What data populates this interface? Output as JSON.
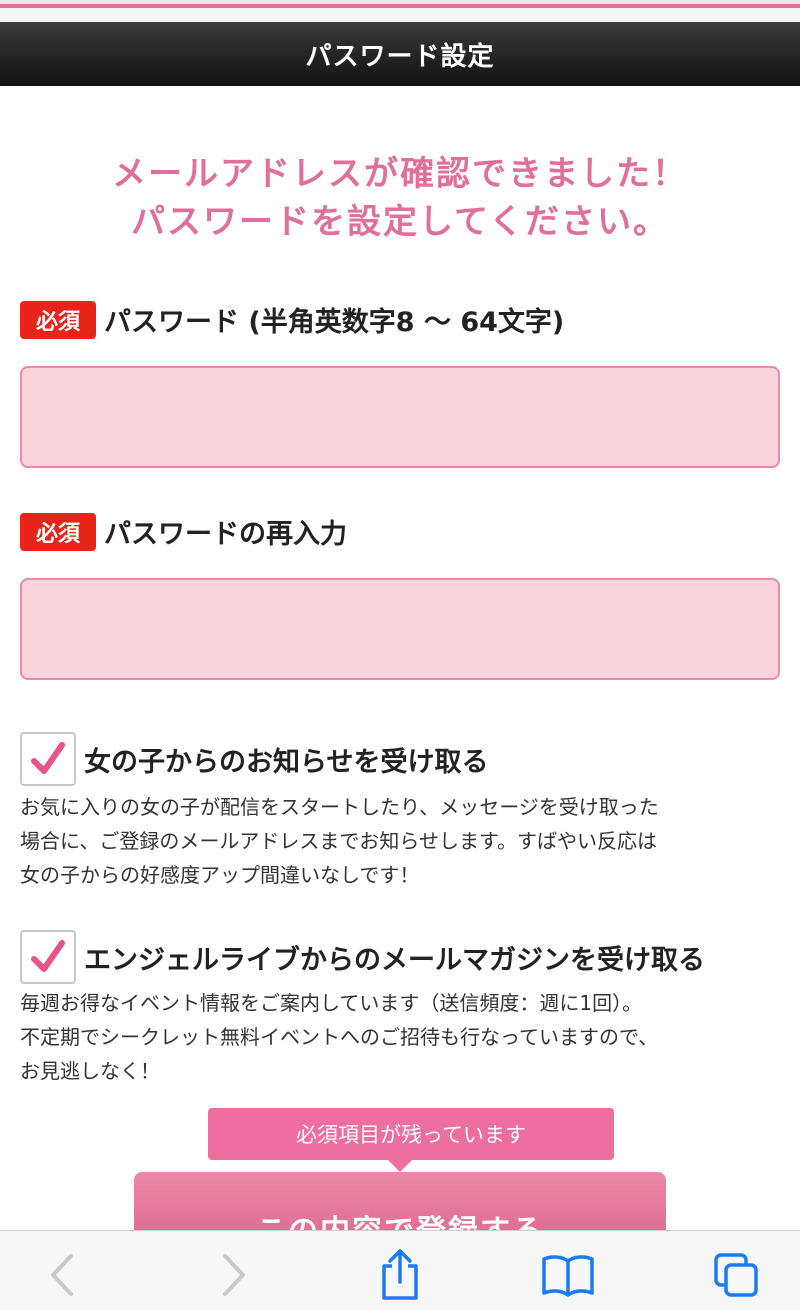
{
  "header": {
    "title": "パスワード設定"
  },
  "headline": {
    "line1": "メールアドレスが確認できました！",
    "line2": "パスワードを設定してください。"
  },
  "form": {
    "password": {
      "required_badge": "必須",
      "label": "パスワード (半角英数字8 〜 64文字)",
      "value": ""
    },
    "password_confirm": {
      "required_badge": "必須",
      "label": "パスワードの再入力",
      "value": ""
    }
  },
  "notifications": {
    "girl_news": {
      "checked": true,
      "title": "女の子からのお知らせを受け取る",
      "lines": [
        "お気に入りの女の子が配信をスタートしたり、メッセージを受け取った",
        "場合に、ご登録のメールアドレスまでお知らせします。すばやい反応は",
        "女の子からの好感度アップ間違いなしです！"
      ]
    },
    "magazine": {
      "checked": true,
      "title": "エンジェルライブからのメールマガジンを受け取る",
      "lines": [
        "毎週お得なイベント情報をご案内しています（送信頻度：週に1回）。",
        "不定期でシークレット無料イベントへのご招待も行なっていますので、",
        "お見逃しなく！"
      ]
    }
  },
  "tooltip": {
    "text": "必須項目が残っています"
  },
  "submit": {
    "label": "この内容で登録する"
  },
  "browser_toolbar": {
    "icons": [
      "back-icon",
      "forward-icon",
      "share-icon",
      "bookmarks-icon",
      "tabs-icon"
    ],
    "accent_color": "#1a7cf5",
    "disabled_color": "#c7c7cc"
  },
  "colors": {
    "brand_pink": "#e0709a",
    "required_red": "#e8241a",
    "input_fill": "#f9d3dc"
  }
}
